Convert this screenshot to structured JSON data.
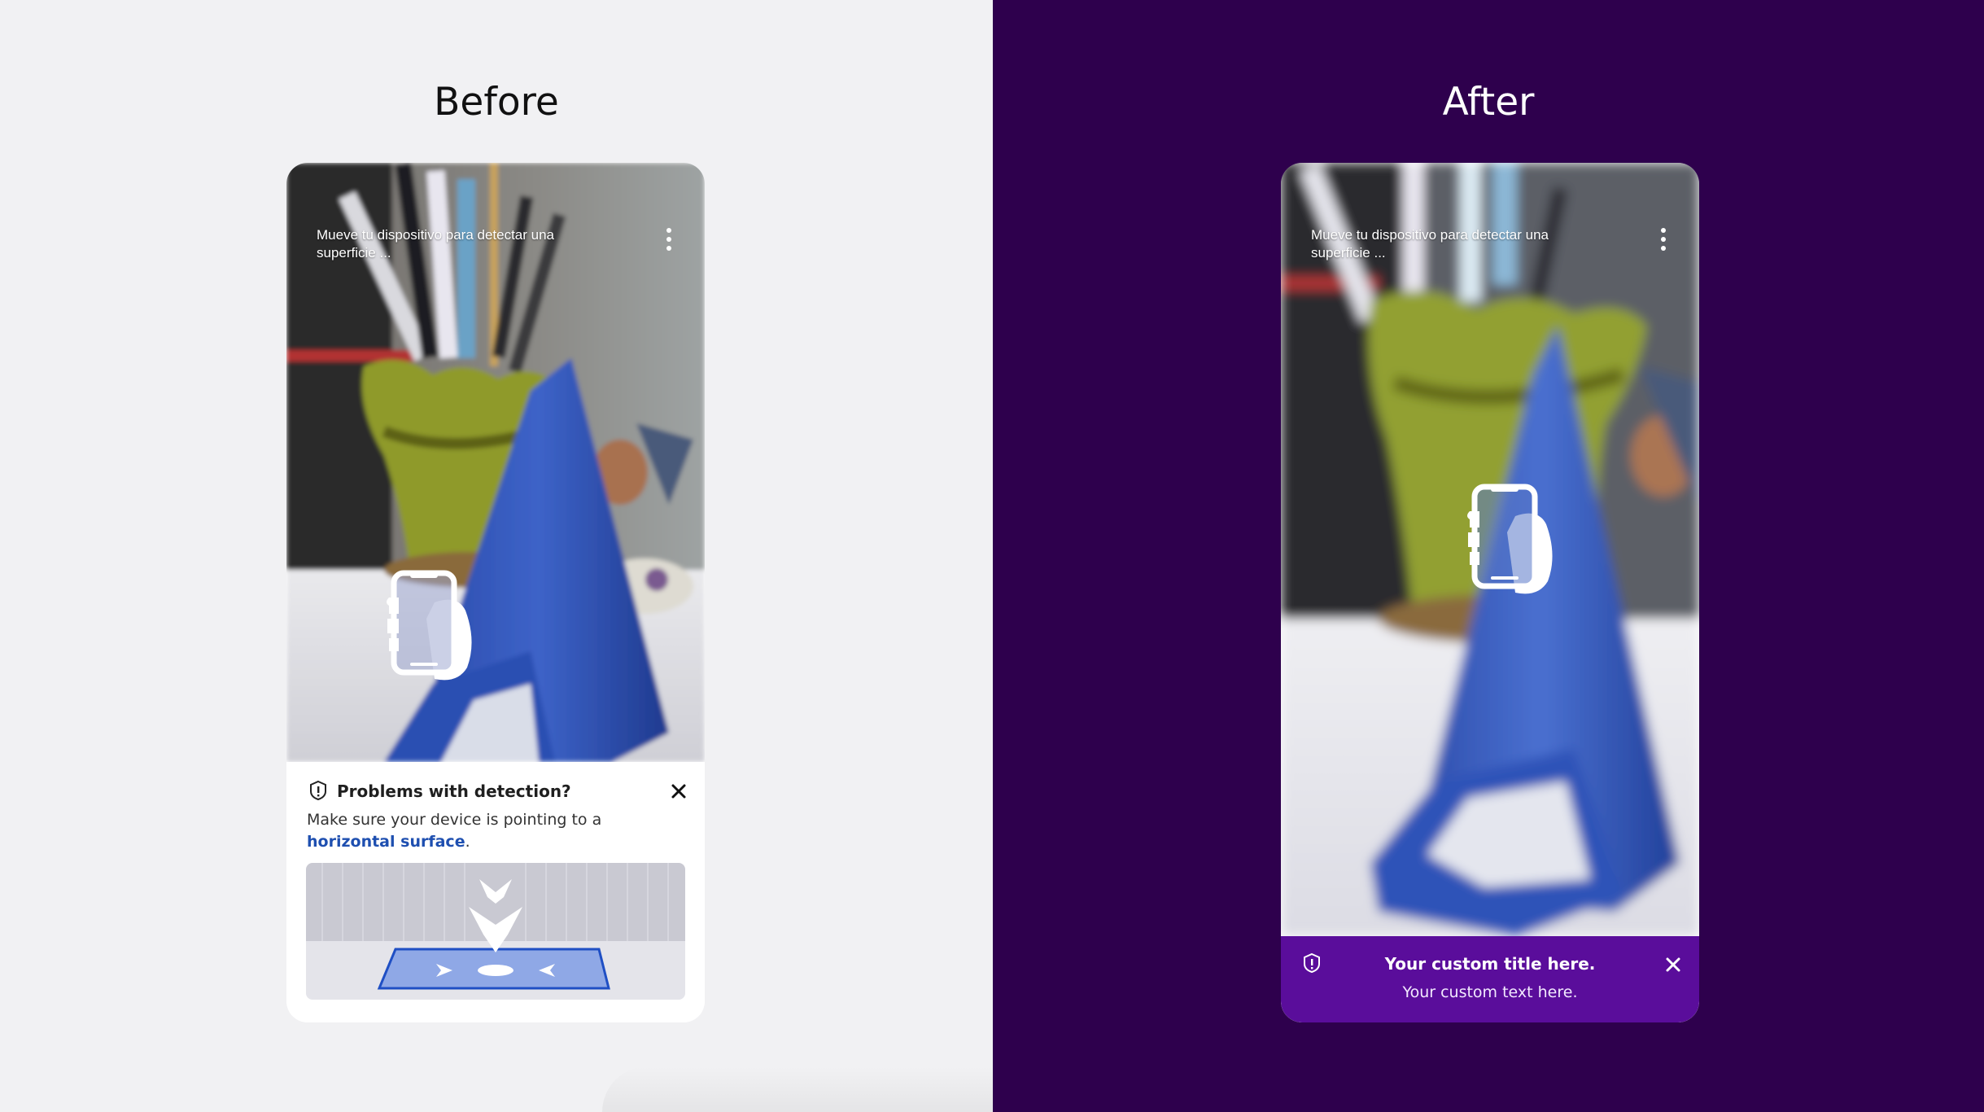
{
  "before": {
    "heading": "Before",
    "camera_hint": "Mueve tu dispositivo para detectar una superficie ...",
    "sheet": {
      "title": "Problems with detection?",
      "body_prefix": "Make sure your device is pointing to a ",
      "body_link": "horizontal surface",
      "body_suffix": ".",
      "icon": "alert-shield-icon",
      "close_icon": "close-icon"
    }
  },
  "after": {
    "heading": "After",
    "camera_hint": "Mueve tu dispositivo para detectar una superficie ...",
    "banner": {
      "title": "Your custom title here.",
      "text": "Your custom text here.",
      "icon": "alert-shield-icon",
      "close_icon": "close-icon"
    }
  },
  "colors": {
    "before_background": "#f1f1f3",
    "after_background": "#2e004d",
    "after_banner": "#5a0d9b",
    "link": "#1e4fb0"
  }
}
